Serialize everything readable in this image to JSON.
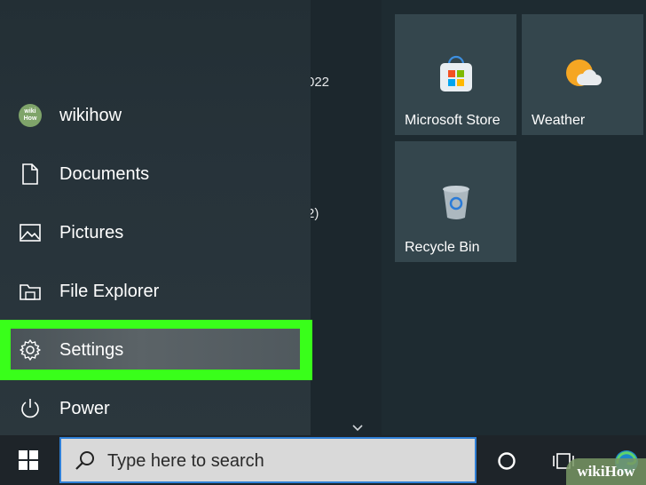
{
  "start_menu": {
    "rail": [
      {
        "label": "wikihow",
        "icon": "user-avatar"
      },
      {
        "label": "Documents",
        "icon": "document-icon"
      },
      {
        "label": "Pictures",
        "icon": "pictures-icon"
      },
      {
        "label": "File Explorer",
        "icon": "folder-icon"
      },
      {
        "label": "Settings",
        "icon": "gear-icon"
      },
      {
        "label": "Power",
        "icon": "power-icon"
      }
    ],
    "avatar_text_top": "wiki",
    "avatar_text_bottom": "How",
    "app_list_fragments": [
      "022",
      "2)"
    ],
    "tiles": [
      {
        "label": "Microsoft Store",
        "icon": "store-icon"
      },
      {
        "label": "Weather",
        "icon": "weather-icon"
      },
      {
        "label": "Recycle Bin",
        "icon": "recycle-bin-icon"
      }
    ],
    "highlight_color": "#39ff1a"
  },
  "taskbar": {
    "search_placeholder": "Type here to search",
    "search_border_color": "#2f7fd6"
  },
  "watermark": "wikiHow"
}
